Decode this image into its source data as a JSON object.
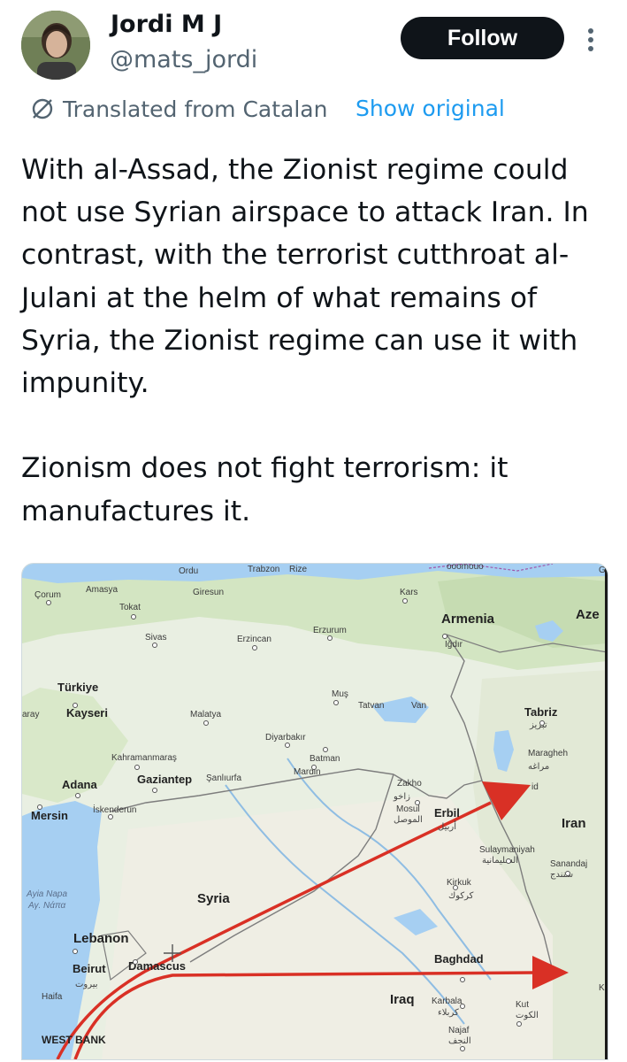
{
  "author": {
    "name": "Jordi M J",
    "handle": "@mats_jordi"
  },
  "actions": {
    "follow_label": "Follow",
    "more_icon": "more-vertical-icon"
  },
  "translation": {
    "notice": "Translated from Catalan",
    "show_original": "Show original"
  },
  "tweet": {
    "text": "With al-Assad, the Zionist regime could not use Syrian airspace to attack Iran. In contrast, with the terrorist cutthroat al-Julani at the helm of what remains of Syria, the Zionist regime can use it with impunity.\n\nZionism does not fight terrorism: it manufactures it."
  },
  "map": {
    "labels": {
      "ordu": "Ordu",
      "trabzon": "Trabzon",
      "rize": "Rize",
      "corum": "Çorum",
      "amasya": "Amasya",
      "tokat": "Tokat",
      "giresun": "Giresun",
      "kars": "Kars",
      "armenia": "Armenia",
      "aze": "Aze",
      "sivas": "Sivas",
      "erzincan": "Erzincan",
      "erzurum": "Erzurum",
      "igdir": "Iğdır",
      "turkiye": "Türkiye",
      "aray": "aray",
      "kayseri": "Kayseri",
      "malatya": "Malatya",
      "mus": "Muş",
      "tatvan": "Tatvan",
      "van": "Van",
      "tabriz": "Tabriz",
      "tabriz_fa": "تبریز",
      "diyarbakir": "Diyarbakır",
      "kahramanmaras": "Kahramanmaraş",
      "batman": "Batman",
      "mardin": "Mardin",
      "maragheh": "Maragheh",
      "maragheh_fa": "مراغه",
      "adana": "Adana",
      "gaziantep": "Gaziantep",
      "sanliurfa": "Şanlıurfa",
      "zakho": "Zakho",
      "zakho_ar": "زاخو",
      "mersin": "Mersin",
      "iskenderun": "İskenderun",
      "mosul": "Mosul",
      "mosul_ar": "الموصل",
      "erbil": "Erbil",
      "erbil_ar": "أربيل",
      "iran": "Iran",
      "sulaymaniyah": "Sulaymaniyah",
      "sulaymaniyah_ar": "السليمانية",
      "sanandaj": "Sanandaj",
      "sanandaj_fa": "سنندج",
      "ayia_napa": "Ayia Napa",
      "ayia_napa_gr": "Αγ. Νάπα",
      "syria": "Syria",
      "kirkuk": "Kirkuk",
      "kirkuk_ar": "كركوك",
      "lebanon": "Lebanon",
      "beirut": "Beirut",
      "beirut_ar": "بيروت",
      "damascus": "Damascus",
      "baghdad": "Baghdad",
      "haifa": "Haifa",
      "iraq": "Iraq",
      "karbala": "Karbala",
      "karbala_ar": "كربلاء",
      "kut": "Kut",
      "kut_ar": "الكوت",
      "najaf": "Najaf",
      "najaf_ar": "النجف",
      "west_bank": "WEST BANK",
      "k": "K",
      "g": "G",
      "id": "id",
      "moomouo": "ooomouo"
    },
    "colors": {
      "land": "#e9efe2",
      "green": "#cfe3bd",
      "water": "#a6cff2",
      "arrow": "#d93025",
      "border": "#7d7d7d"
    }
  }
}
